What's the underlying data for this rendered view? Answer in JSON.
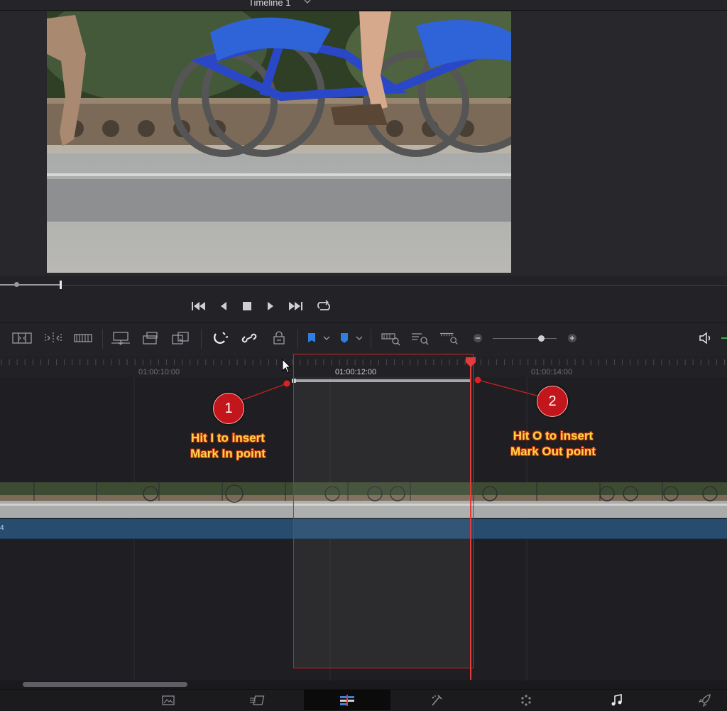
{
  "viewer": {
    "timeline_name": "Timeline 1",
    "timeline_dropdown_icon": "chevron-down-icon",
    "frame_description_icon": "video-frame"
  },
  "transport": {
    "buttons": [
      {
        "name": "go-to-start",
        "icon": "skip-back-icon"
      },
      {
        "name": "play-reverse",
        "icon": "play-reverse-icon"
      },
      {
        "name": "stop",
        "icon": "stop-icon"
      },
      {
        "name": "play",
        "icon": "play-icon"
      },
      {
        "name": "go-to-end",
        "icon": "skip-forward-icon"
      },
      {
        "name": "loop",
        "icon": "loop-icon"
      }
    ]
  },
  "toolbar": {
    "tools": [
      "trim-edit-icon",
      "dynamic-trim-icon",
      "blade-icon",
      "insert-clip-icon",
      "overwrite-clip-icon",
      "replace-clip-icon",
      "snapping-icon",
      "linked-selection-icon",
      "position-lock-icon",
      "flag-icon",
      "marker-icon",
      "zoom-full-icon",
      "zoom-detail-icon",
      "zoom-custom-icon",
      "zoom-out-icon",
      "zoom-in-icon",
      "audio-volume-icon"
    ],
    "flag_color": "#2f7fe0",
    "marker_color": "#2f7fe0"
  },
  "ruler": {
    "timecodes": [
      "01:00:10:00",
      "01:00:12:00",
      "01:00:14:00"
    ]
  },
  "tracks": {
    "audio_clip_label": "4"
  },
  "annotations": [
    {
      "number": "1",
      "text_line1": "Hit I to insert",
      "text_line2": "Mark In point"
    },
    {
      "number": "2",
      "text_line1": "Hit O to insert",
      "text_line2": "Mark Out point"
    }
  ],
  "colors": {
    "playhead": "#e23c3c",
    "annotation_red": "#c3161c",
    "annotation_text": "#ffd54a",
    "audio_clip": "#284c6e"
  },
  "pages": [
    {
      "name": "media",
      "icon": "media-page-icon",
      "active": false
    },
    {
      "name": "cut",
      "icon": "cut-page-icon",
      "active": false
    },
    {
      "name": "edit",
      "icon": "edit-page-icon",
      "active": true
    },
    {
      "name": "fusion",
      "icon": "fusion-page-icon",
      "active": false
    },
    {
      "name": "color",
      "icon": "color-page-icon",
      "active": false
    },
    {
      "name": "fairlight",
      "icon": "fairlight-page-icon",
      "active": false
    },
    {
      "name": "deliver",
      "icon": "deliver-page-icon",
      "active": false
    }
  ]
}
